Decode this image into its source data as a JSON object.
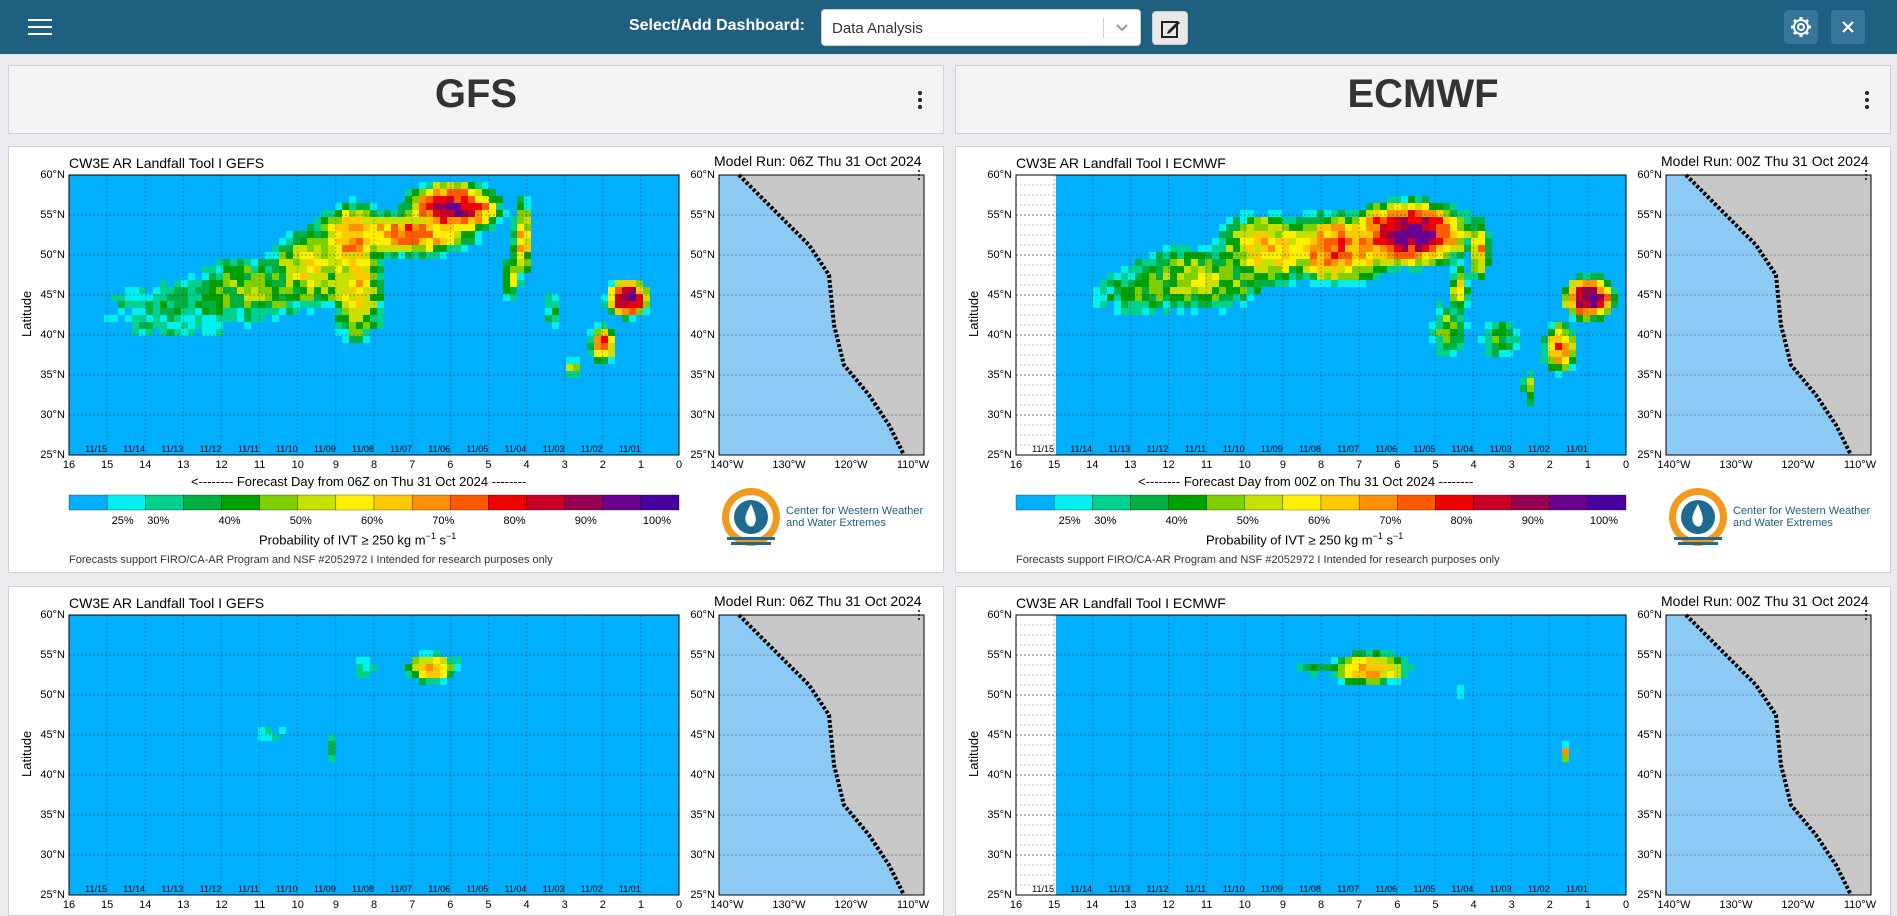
{
  "topbar": {
    "dashboard_label": "Select/Add Dashboard:",
    "dashboard_value": "Data Analysis"
  },
  "columns": [
    {
      "title": "GFS"
    },
    {
      "title": "ECMWF"
    }
  ],
  "panels": [
    {
      "title": "CW3E AR Landfall Tool I GEFS",
      "model_run": "Model Run: 06Z Thu 31 Oct 2024",
      "forecast_label": "<-------- Forecast Day from 06Z on Thu 31 Oct 2024 --------",
      "mask": false
    },
    {
      "title": "CW3E AR Landfall Tool I ECMWF",
      "model_run": "Model Run: 00Z Thu 31 Oct 2024",
      "forecast_label": "<-------- Forecast Day from 00Z on Thu 31 Oct 2024 --------",
      "mask": true
    },
    {
      "title": "CW3E AR Landfall Tool I GEFS",
      "model_run": "Model Run: 06Z Thu 31 Oct 2024",
      "forecast_label": "",
      "mask": false
    },
    {
      "title": "CW3E AR Landfall Tool I ECMWF",
      "model_run": "Model Run: 00Z Thu 31 Oct 2024",
      "forecast_label": "",
      "mask": true
    }
  ],
  "common": {
    "ylabel": "Latitude",
    "lat_ticks": [
      "60°N",
      "55°N",
      "50°N",
      "45°N",
      "40°N",
      "35°N",
      "30°N",
      "25°N"
    ],
    "day_ticks": [
      "16",
      "15",
      "14",
      "13",
      "12",
      "11",
      "10",
      "9",
      "8",
      "7",
      "6",
      "5",
      "4",
      "3",
      "2",
      "1",
      "0"
    ],
    "date_ticks": [
      "11/15",
      "11/14",
      "11/13",
      "11/12",
      "11/11",
      "11/10",
      "11/09",
      "11/08",
      "11/07",
      "11/06",
      "11/05",
      "11/04",
      "11/03",
      "11/02",
      "11/01"
    ],
    "lon_ticks": [
      "140°W",
      "130°W",
      "120°W",
      "110°W"
    ],
    "pct_ticks": [
      "25%",
      "30%",
      "40%",
      "50%",
      "60%",
      "70%",
      "80%",
      "90%",
      "100%"
    ],
    "prob_label_main": "Probability of IVT ≥ 250 kg m",
    "prob_label_sup1": "−1",
    "prob_label_mid": " s",
    "prob_label_sup2": "−1",
    "footer": "Forecasts support FIRO/CA-AR Program and NSF #2052972 I Intended for research purposes only",
    "logo_line1": "Center for Western Weather",
    "logo_line2": "and Water Extremes",
    "colorbar": [
      "#00b0ff",
      "#00f0f0",
      "#00d090",
      "#00b040",
      "#00a000",
      "#80d000",
      "#c8e000",
      "#fff000",
      "#ffc800",
      "#ff9000",
      "#ff5a00",
      "#f00000",
      "#c80028",
      "#960050",
      "#6a0090",
      "#4a00a0"
    ]
  }
}
